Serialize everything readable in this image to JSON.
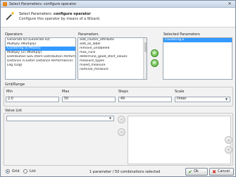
{
  "window": {
    "title": "Select Parameters: configure operator",
    "close_glyph": "✕"
  },
  "header": {
    "title_prefix": "Select Parameters: ",
    "title_bold": "configure operator",
    "subtitle": "Configure this operator by means of a Wizard."
  },
  "operators": {
    "label": "Operators",
    "items": [
      {
        "label": "Generate ID (Generate ID)",
        "selected": false
      },
      {
        "label": "Multiply (Multiply)",
        "selected": false
      },
      {
        "label": "Clustering (k-Means)",
        "selected": true
      },
      {
        "label": "Multiply (2) (Multiply)",
        "selected": false
      },
      {
        "label": "Distribution SoS (Item Distribution Perform",
        "selected": false
      },
      {
        "label": "Distance (Cluster Distance Performance)",
        "selected": false
      },
      {
        "label": "Log (Log)",
        "selected": false
      }
    ]
  },
  "parameters": {
    "label": "Parameters",
    "items": [
      {
        "label": "add_cluster_attribute"
      },
      {
        "label": "add_as_label"
      },
      {
        "label": "remove_unlabeled"
      },
      {
        "label": "max_runs"
      },
      {
        "label": "determine_good_start_values"
      },
      {
        "label": "measure_types"
      },
      {
        "label": "mixed_measure"
      },
      {
        "label": "nominal_measure"
      }
    ]
  },
  "transfer": {
    "add_glyph": "»",
    "remove_glyph": "«"
  },
  "selected_parameters": {
    "label": "Selected Parameters",
    "items": [
      {
        "label": "Clustering.k",
        "selected": true
      }
    ]
  },
  "grid_range": {
    "label": "Grid/Range",
    "min_label": "Min",
    "min_value": "2.0",
    "max_label": "Max",
    "max_value": "50",
    "steps_label": "Steps",
    "steps_value": "49",
    "scale_label": "Scale",
    "scale_value": "linear"
  },
  "value_list": {
    "label": "Value List",
    "add_glyph": "»",
    "remove_glyph": "«"
  },
  "footer": {
    "grid_label": "Grid",
    "list_label": "List",
    "grid_selected": true,
    "status": "1 parameter / 50 combinations selected",
    "ok_label": "Ok",
    "cancel_label": "Cancel"
  }
}
